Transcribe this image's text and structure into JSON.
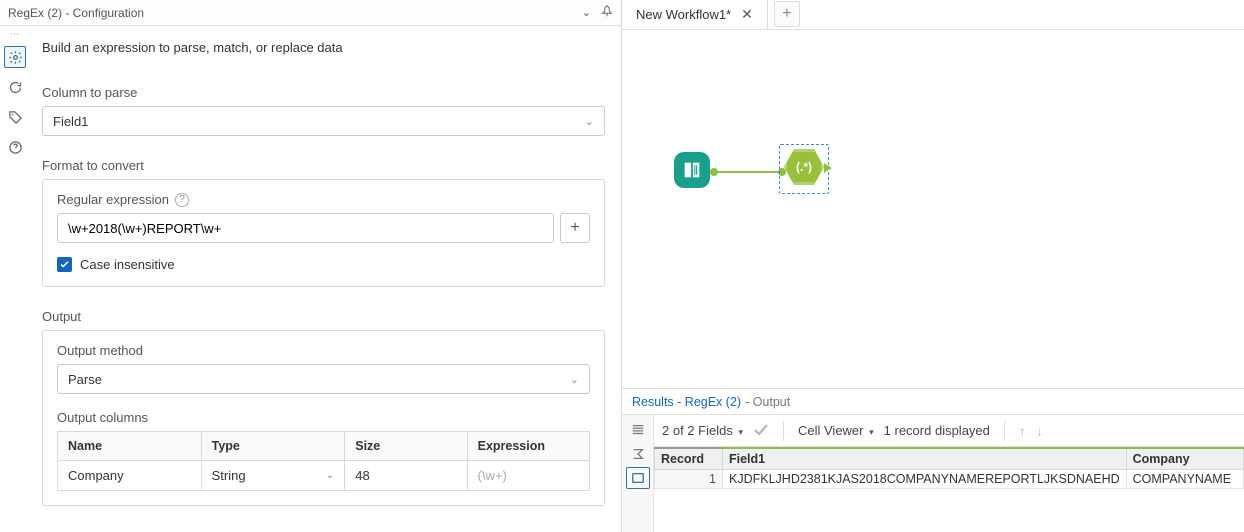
{
  "titlebar": {
    "title": "RegEx (2) - Configuration"
  },
  "config": {
    "intro": "Build an expression to parse, match, or replace data",
    "column_label": "Column to parse",
    "column_value": "Field1",
    "format_label": "Format to convert",
    "regex_label": "Regular expression",
    "regex_value": "\\w+2018(\\w+)REPORT\\w+",
    "case_insensitive_label": "Case insensitive",
    "output_label": "Output",
    "method_label": "Output method",
    "method_value": "Parse",
    "columns_label": "Output columns",
    "columns_header": {
      "name": "Name",
      "type": "Type",
      "size": "Size",
      "expression": "Expression"
    },
    "columns_row": {
      "name": "Company",
      "type": "String",
      "size": "48",
      "expression": "(\\w+)"
    }
  },
  "canvas": {
    "tab": "New Workflow1*",
    "regex_label": "(.*)"
  },
  "results": {
    "title_link": "Results - RegEx (2)",
    "title_suffix": "- Output",
    "fields_text": "2 of 2 Fields",
    "cell_viewer": "Cell Viewer",
    "records_text": "1 record displayed",
    "headers": {
      "record": "Record",
      "field1": "Field1",
      "company": "Company"
    },
    "row": {
      "record": "1",
      "field1": "KJDFKLJHD2381KJAS2018COMPANYNAMEREPORTLJKSDNAEHD",
      "company": "COMPANYNAME"
    }
  }
}
